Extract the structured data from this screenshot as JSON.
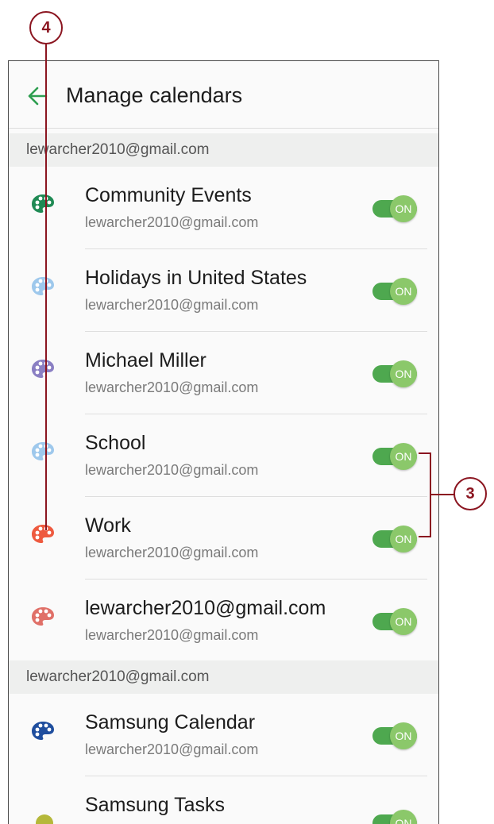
{
  "header": {
    "title": "Manage calendars"
  },
  "sections": [
    {
      "label": "lewarcher2010@gmail.com",
      "items": [
        {
          "title": "Community Events",
          "account": "lewarcher2010@gmail.com",
          "color": "#1f8a54",
          "toggle": "ON"
        },
        {
          "title": "Holidays in United States",
          "account": "lewarcher2010@gmail.com",
          "color": "#9ec8ec",
          "toggle": "ON"
        },
        {
          "title": "Michael Miller",
          "account": "lewarcher2010@gmail.com",
          "color": "#8a7fc3",
          "toggle": "ON"
        },
        {
          "title": "School",
          "account": "lewarcher2010@gmail.com",
          "color": "#9ec8ec",
          "toggle": "ON"
        },
        {
          "title": "Work",
          "account": "lewarcher2010@gmail.com",
          "color": "#ee5a3f",
          "toggle": "ON"
        },
        {
          "title": "lewarcher2010@gmail.com",
          "account": "lewarcher2010@gmail.com",
          "color": "#e07068",
          "toggle": "ON"
        }
      ]
    },
    {
      "label": "lewarcher2010@gmail.com",
      "items": [
        {
          "title": "Samsung Calendar",
          "account": "lewarcher2010@gmail.com",
          "color": "#1f4e9e",
          "toggle": "ON"
        },
        {
          "title": "Samsung Tasks",
          "color": "#b5b83a",
          "toggle": "ON"
        }
      ]
    }
  ],
  "callouts": {
    "top": "4",
    "right": "3"
  },
  "colors": {
    "accent": "#4ea84f",
    "callout": "#8b1520",
    "back_arrow": "#2e9e50"
  }
}
